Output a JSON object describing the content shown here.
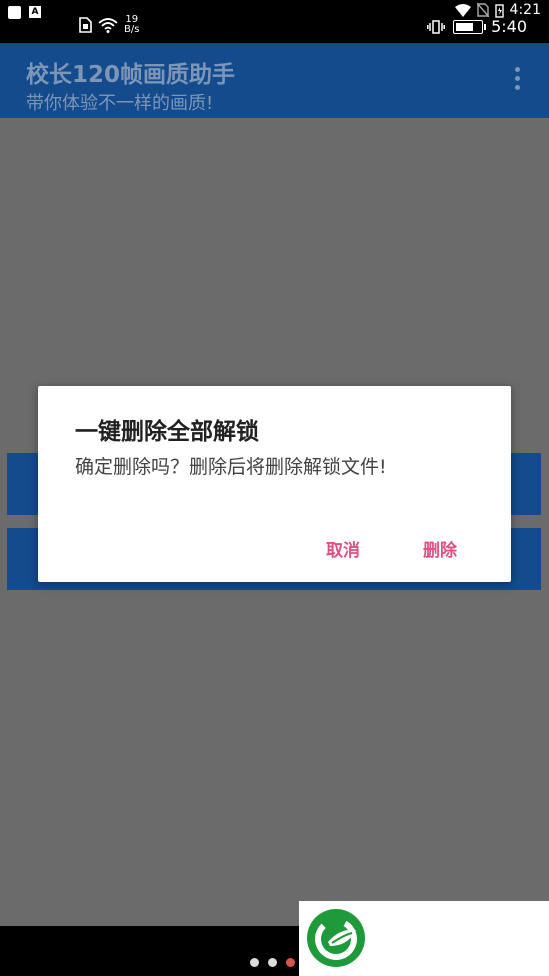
{
  "status_bar": {
    "time_top": "4:21",
    "time_bottom": "5:40",
    "net_speed_value": "19",
    "net_speed_unit": "B/s",
    "left_letter": "A",
    "battery_level": 0.7
  },
  "app_bar": {
    "title": "校长120帧画质助手",
    "subtitle": "带你体验不一样的画质!"
  },
  "dialog": {
    "title": "一键删除全部解锁",
    "message": "确定删除吗？删除后将删除解锁文件!",
    "cancel_label": "取消",
    "confirm_label": "删除"
  },
  "pager": {
    "count": 3,
    "active_index": 2
  },
  "colors": {
    "status_bar_bg": "#000000",
    "app_bar_bg": "#134b8c",
    "overlay_bg": "#6b6b6b",
    "dialog_bg": "#ffffff",
    "accent": "#e0507f",
    "logo_green": "#1e9a3b"
  }
}
